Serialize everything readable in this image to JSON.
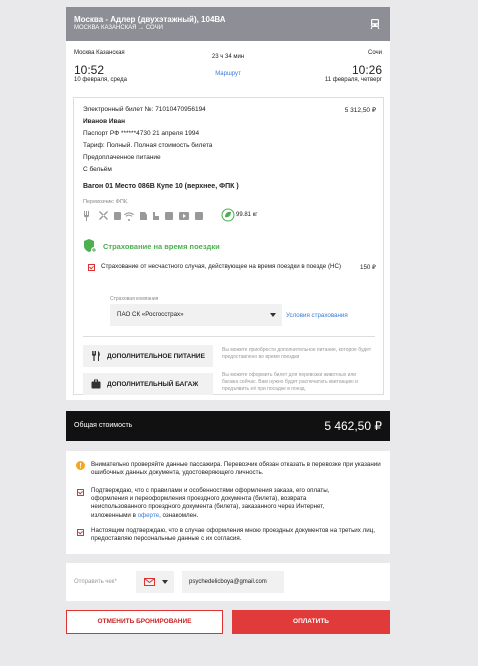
{
  "train": {
    "title": "Москва - Адлер (двухэтажный), 104ВА",
    "subtitle": "МОСКВА КАЗАНСКАЯ → СОЧИ"
  },
  "route": {
    "from_city": "Москва Казанская",
    "to_city": "Сочи",
    "depart_time": "10:52",
    "arrive_time": "10:26",
    "depart_date": "10 февраля, среда",
    "arrive_date": "11 февраля, четверг",
    "duration": "23 ч 34 мин",
    "map_link": "Маршрут"
  },
  "ticket": {
    "number": "Электронный билет №: 71010470956194",
    "price": "5 312,50 ₽",
    "passenger": "Иванов Иван",
    "passport": "Паспорт РФ ******4730 21 апреля 1994",
    "tariff": "Тариф: Полный.  Полная стоимость билета",
    "food": "Предоплаченное питание",
    "linen": "С бельём",
    "seat": "Вагон 01 Место 086В Купе 10 (верхнее,  ФПК )",
    "carrier": "Перевозчик: ФПК.",
    "eco": "99.81 кг"
  },
  "insurance": {
    "title": "Страхование на время поездки",
    "item_label": "Страхование от несчастного случая, действующее на время поездки в поезде (НС)",
    "item_price": "150 ₽",
    "company_label": "Страховая компания",
    "company_value": "ПАО СК «Росгосстрах»",
    "conditions_link": "Условия страхования"
  },
  "extras": {
    "food_button": "ДОПОЛНИТЕЛЬНОЕ ПИТАНИЕ",
    "food_note": "Вы можете приобрести дополнительное питание, которое будет предоставлено во время поездки",
    "baggage_button": "ДОПОЛНИТЕЛЬНЫЙ БАГАЖ",
    "baggage_note": "Вы можете оформить билет для перевозки животных или багажа сейчас. Вам нужно будет распечатать квитанцию и предъявить её при посадке в поезд."
  },
  "total": {
    "label": "Общая стоимость",
    "value": "5 462,50 ₽"
  },
  "notes": {
    "warning": "Внимательно проверяйте данные пассажира. Перевозчик обязан отказать в перевозке при указании ошибочных данных документа, удостоверяющего личность.",
    "agree_rules_1": "Подтверждаю, что с правилами и особенностями оформления заказа, его оплаты,",
    "agree_rules_2": "оформления и переоформления проездного документа (билета), возврата",
    "agree_rules_3": "неиспользованного проездного документа (билета), заказанного через Интернет,",
    "agree_rules_4a": "изложенными в ",
    "agree_rules_link": "оферте",
    "agree_rules_4b": ", ознакомлен.",
    "agree_third_party": "Настоящим подтверждаю, что в случае оформления мною проездных документов на третьих лиц, предоставляю персональные данные с их согласия."
  },
  "receipt": {
    "label": "Отправить чек*",
    "email": "psychedelicboya@gmail.com"
  },
  "actions": {
    "cancel": "ОТМЕНИТЬ БРОНИРОВАНИЕ",
    "pay": "ОПЛАТИТЬ"
  },
  "colors": {
    "accent_red": "#e03a3a",
    "insurance_green": "#4caf50",
    "link_blue": "#3a7bd5",
    "warning_orange": "#f5a623"
  }
}
